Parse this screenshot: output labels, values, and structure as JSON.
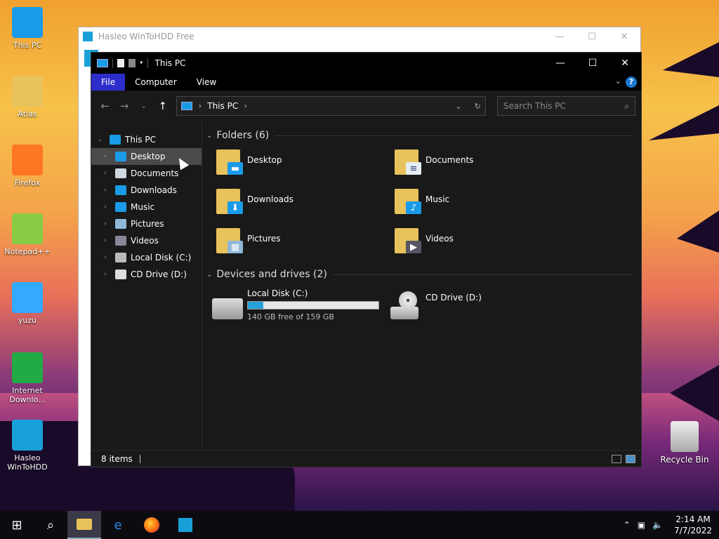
{
  "desktop": {
    "icons": [
      {
        "label": "This PC",
        "icon": "computer-icon"
      },
      {
        "label": "Atlas",
        "icon": "folder-icon"
      },
      {
        "label": "Firefox",
        "icon": "firefox-icon"
      },
      {
        "label": "Notepad++",
        "icon": "notepad-icon"
      },
      {
        "label": "yuzu",
        "icon": "yuzu-icon"
      },
      {
        "label": "Internet Downlo...",
        "icon": "idm-icon"
      },
      {
        "label": "Hasleo WinToHDD",
        "icon": "wintohdd-icon"
      }
    ],
    "recycle_bin": "Recycle Bin"
  },
  "background_window": {
    "title": "Hasleo WinToHDD Free",
    "controls": [
      "—",
      "☐",
      "✕"
    ]
  },
  "explorer": {
    "title": "This PC",
    "ribbon_tabs": [
      "File",
      "Computer",
      "View"
    ],
    "help": "?",
    "address_crumb": "This PC",
    "search_placeholder": "Search This PC",
    "tree": [
      {
        "label": "This PC",
        "icon": "computer-icon",
        "color": "#1a9be8",
        "expanded": true
      },
      {
        "label": "Desktop",
        "icon": "desktop-icon",
        "color": "#1a9be8"
      },
      {
        "label": "Documents",
        "icon": "documents-icon",
        "color": "#cfd8e0"
      },
      {
        "label": "Downloads",
        "icon": "downloads-icon",
        "color": "#1a9be8"
      },
      {
        "label": "Music",
        "icon": "music-icon",
        "color": "#1a9be8"
      },
      {
        "label": "Pictures",
        "icon": "pictures-icon",
        "color": "#8fb8d8"
      },
      {
        "label": "Videos",
        "icon": "videos-icon",
        "color": "#889"
      },
      {
        "label": "Local Disk (C:)",
        "icon": "disk-icon",
        "color": "#bbb"
      },
      {
        "label": "CD Drive (D:)",
        "icon": "cd-icon",
        "color": "#ddd"
      }
    ],
    "folders_header": "Folders (6)",
    "folders": [
      {
        "name": "Desktop",
        "icon": "desktop-icon",
        "mark": "▬",
        "mark_color": "#1a9be8"
      },
      {
        "name": "Documents",
        "icon": "documents-icon",
        "mark": "≡",
        "mark_color": "#e6eef5"
      },
      {
        "name": "Downloads",
        "icon": "downloads-icon",
        "mark": "⬇",
        "mark_color": "#1a9be8"
      },
      {
        "name": "Music",
        "icon": "music-icon",
        "mark": "♪",
        "mark_color": "#1a9be8"
      },
      {
        "name": "Pictures",
        "icon": "pictures-icon",
        "mark": "▦",
        "mark_color": "#8fb8d8"
      },
      {
        "name": "Videos",
        "icon": "videos-icon",
        "mark": "▶",
        "mark_color": "#556"
      }
    ],
    "drives_header": "Devices and drives (2)",
    "drives": [
      {
        "name": "Local Disk (C:)",
        "free": "140 GB free of 159 GB",
        "used_fraction": 0.12
      },
      {
        "name": "CD Drive (D:)"
      }
    ],
    "status": "8 items"
  },
  "taskbar": {
    "buttons": [
      "windows-start-icon",
      "search-icon",
      "file-explorer-icon",
      "edge-icon",
      "firefox-icon",
      "wintohdd-icon"
    ],
    "time": "2:14 AM",
    "date": "7/7/2022"
  }
}
